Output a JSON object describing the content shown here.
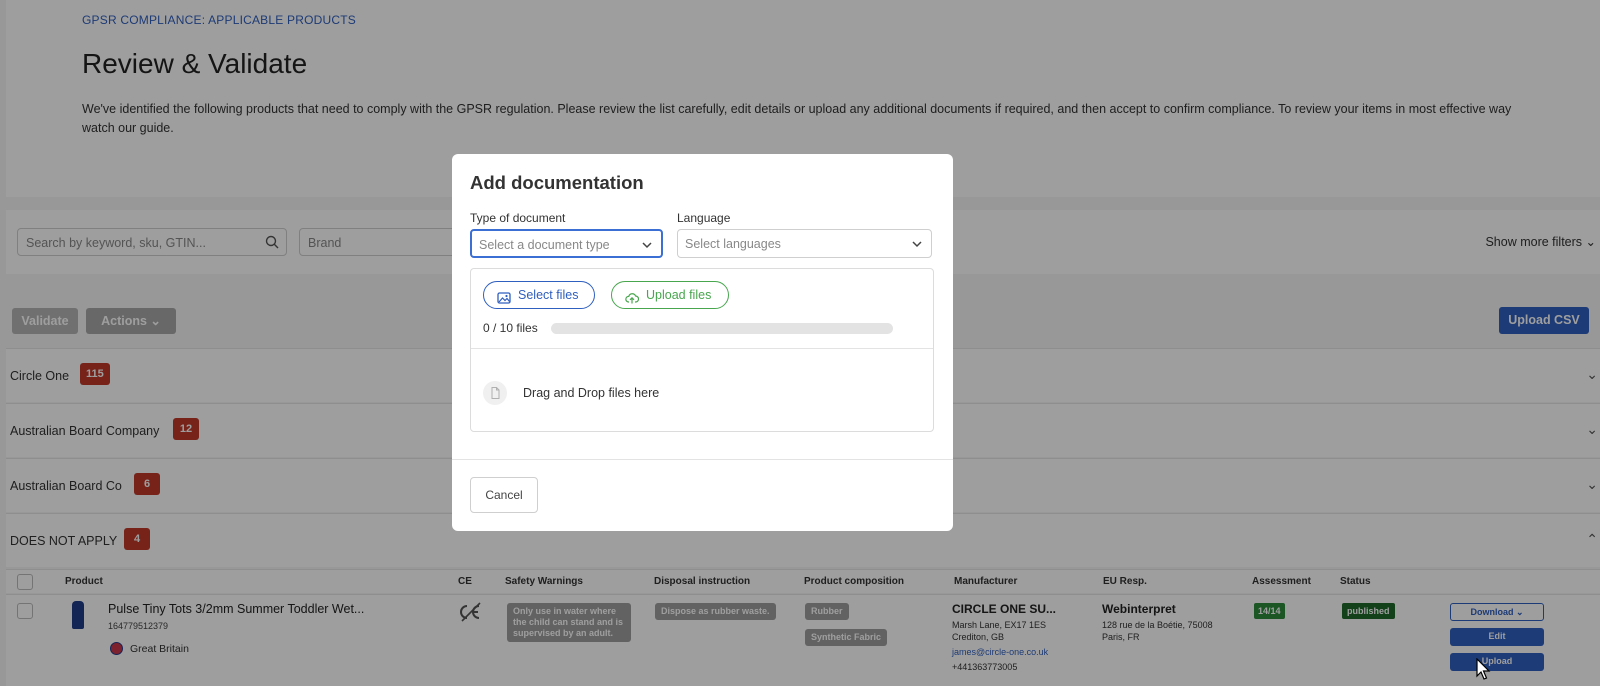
{
  "header": {
    "eyebrow": "GPSR COMPLIANCE: APPLICABLE PRODUCTS",
    "title": "Review & Validate",
    "intro": "We've identified the following products that need to comply with the GPSR regulation. Please review the list carefully, edit details or upload any additional documents if required, and then accept to confirm compliance. To review your items in most effective way watch our guide."
  },
  "filters": {
    "search_placeholder": "Search by keyword, sku, GTIN...",
    "brand_placeholder": "Brand",
    "show_more": "Show more filters"
  },
  "toolbar": {
    "validate": "Validate",
    "actions": "Actions",
    "upload_csv": "Upload CSV"
  },
  "groups": [
    {
      "name": "Circle One",
      "count": "115"
    },
    {
      "name": "Australian Board Company",
      "count": "12"
    },
    {
      "name": "Australian Board Co",
      "count": "6"
    },
    {
      "name": "DOES NOT APPLY",
      "count": "4"
    }
  ],
  "table": {
    "headers": [
      "Product",
      "CE",
      "Safety Warnings",
      "Disposal instruction",
      "Product composition",
      "Manufacturer",
      "EU Resp.",
      "Assessment",
      "Status"
    ],
    "row": {
      "name": "Pulse Tiny Tots 3/2mm Summer Toddler Wet...",
      "sku": "164779512379",
      "country": "Great Britain",
      "safety": "Only use in water where the child can stand and is supervised by an adult.",
      "disposal": "Dispose as rubber waste.",
      "composition": [
        "Rubber",
        "Synthetic Fabric"
      ],
      "manufacturer": {
        "name": "CIRCLE ONE SU...",
        "address1": "Marsh Lane, EX17 1ES",
        "address2": "Crediton, GB",
        "email": "james@circle-one.co.uk",
        "phone": "+441363773005"
      },
      "eu_resp": {
        "name": "Webinterpret",
        "address1": "128 rue de la Boétie, 75008",
        "address2": "Paris, FR"
      },
      "assessment": "14/14",
      "status": "published",
      "actions": {
        "download": "Download",
        "edit": "Edit",
        "upload": "Upload"
      }
    }
  },
  "modal": {
    "title": "Add documentation",
    "type_label": "Type of document",
    "type_placeholder": "Select a document type",
    "language_label": "Language",
    "language_placeholder": "Select languages",
    "select_files": "Select files",
    "upload_files": "Upload files",
    "file_count": "0 / 10 files",
    "progress": 0,
    "drag_drop": "Drag and Drop files here",
    "cancel": "Cancel"
  },
  "colors": {
    "primary": "#2f5fbf",
    "success": "#48a64e",
    "badge": "#c0392b",
    "published": "#1e6a2a"
  }
}
